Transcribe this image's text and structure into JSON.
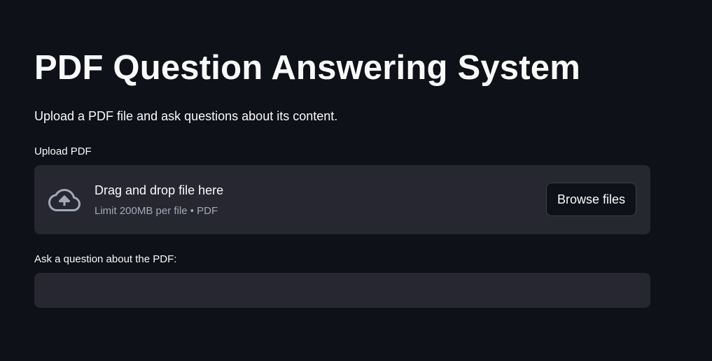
{
  "page": {
    "title": "PDF Question Answering System",
    "subtitle": "Upload a PDF file and ask questions about its content."
  },
  "upload": {
    "label": "Upload PDF",
    "icon": "cloud-upload-icon",
    "drop_text": "Drag and drop file here",
    "limit_text": "Limit 200MB per file • PDF",
    "browse_label": "Browse files"
  },
  "question": {
    "label": "Ask a question about the PDF:",
    "value": "",
    "placeholder": ""
  },
  "colors": {
    "background": "#0e1117",
    "panel": "#262730",
    "text": "#fafafa",
    "muted_text": "#a3a8b8",
    "icon": "#a3a8b8"
  }
}
